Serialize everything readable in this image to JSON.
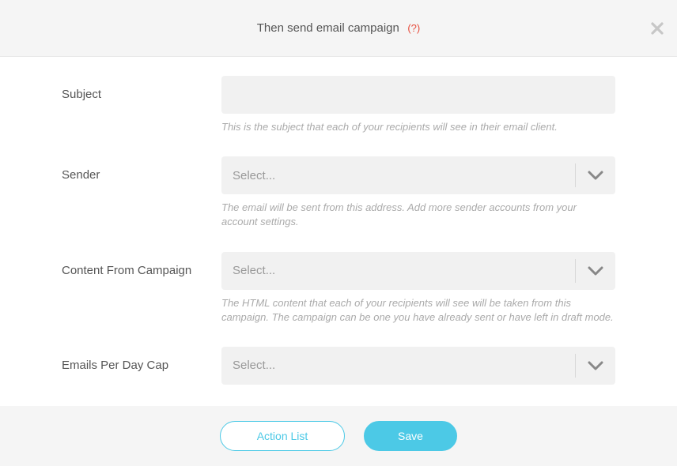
{
  "header": {
    "title": "Then send email campaign",
    "help": "(?)"
  },
  "form": {
    "subject": {
      "label": "Subject",
      "value": "",
      "help": "This is the subject that each of your recipients will see in their email client."
    },
    "sender": {
      "label": "Sender",
      "placeholder": "Select...",
      "help": "The email will be sent from this address. Add more sender accounts from your account settings."
    },
    "content": {
      "label": "Content From Campaign",
      "placeholder": "Select...",
      "help": "The HTML content that each of your recipients will see will be taken from this campaign. The campaign can be one you have already sent or have left in draft mode."
    },
    "cap": {
      "label": "Emails Per Day Cap",
      "placeholder": "Select..."
    }
  },
  "footer": {
    "action_list": "Action List",
    "save": "Save"
  }
}
